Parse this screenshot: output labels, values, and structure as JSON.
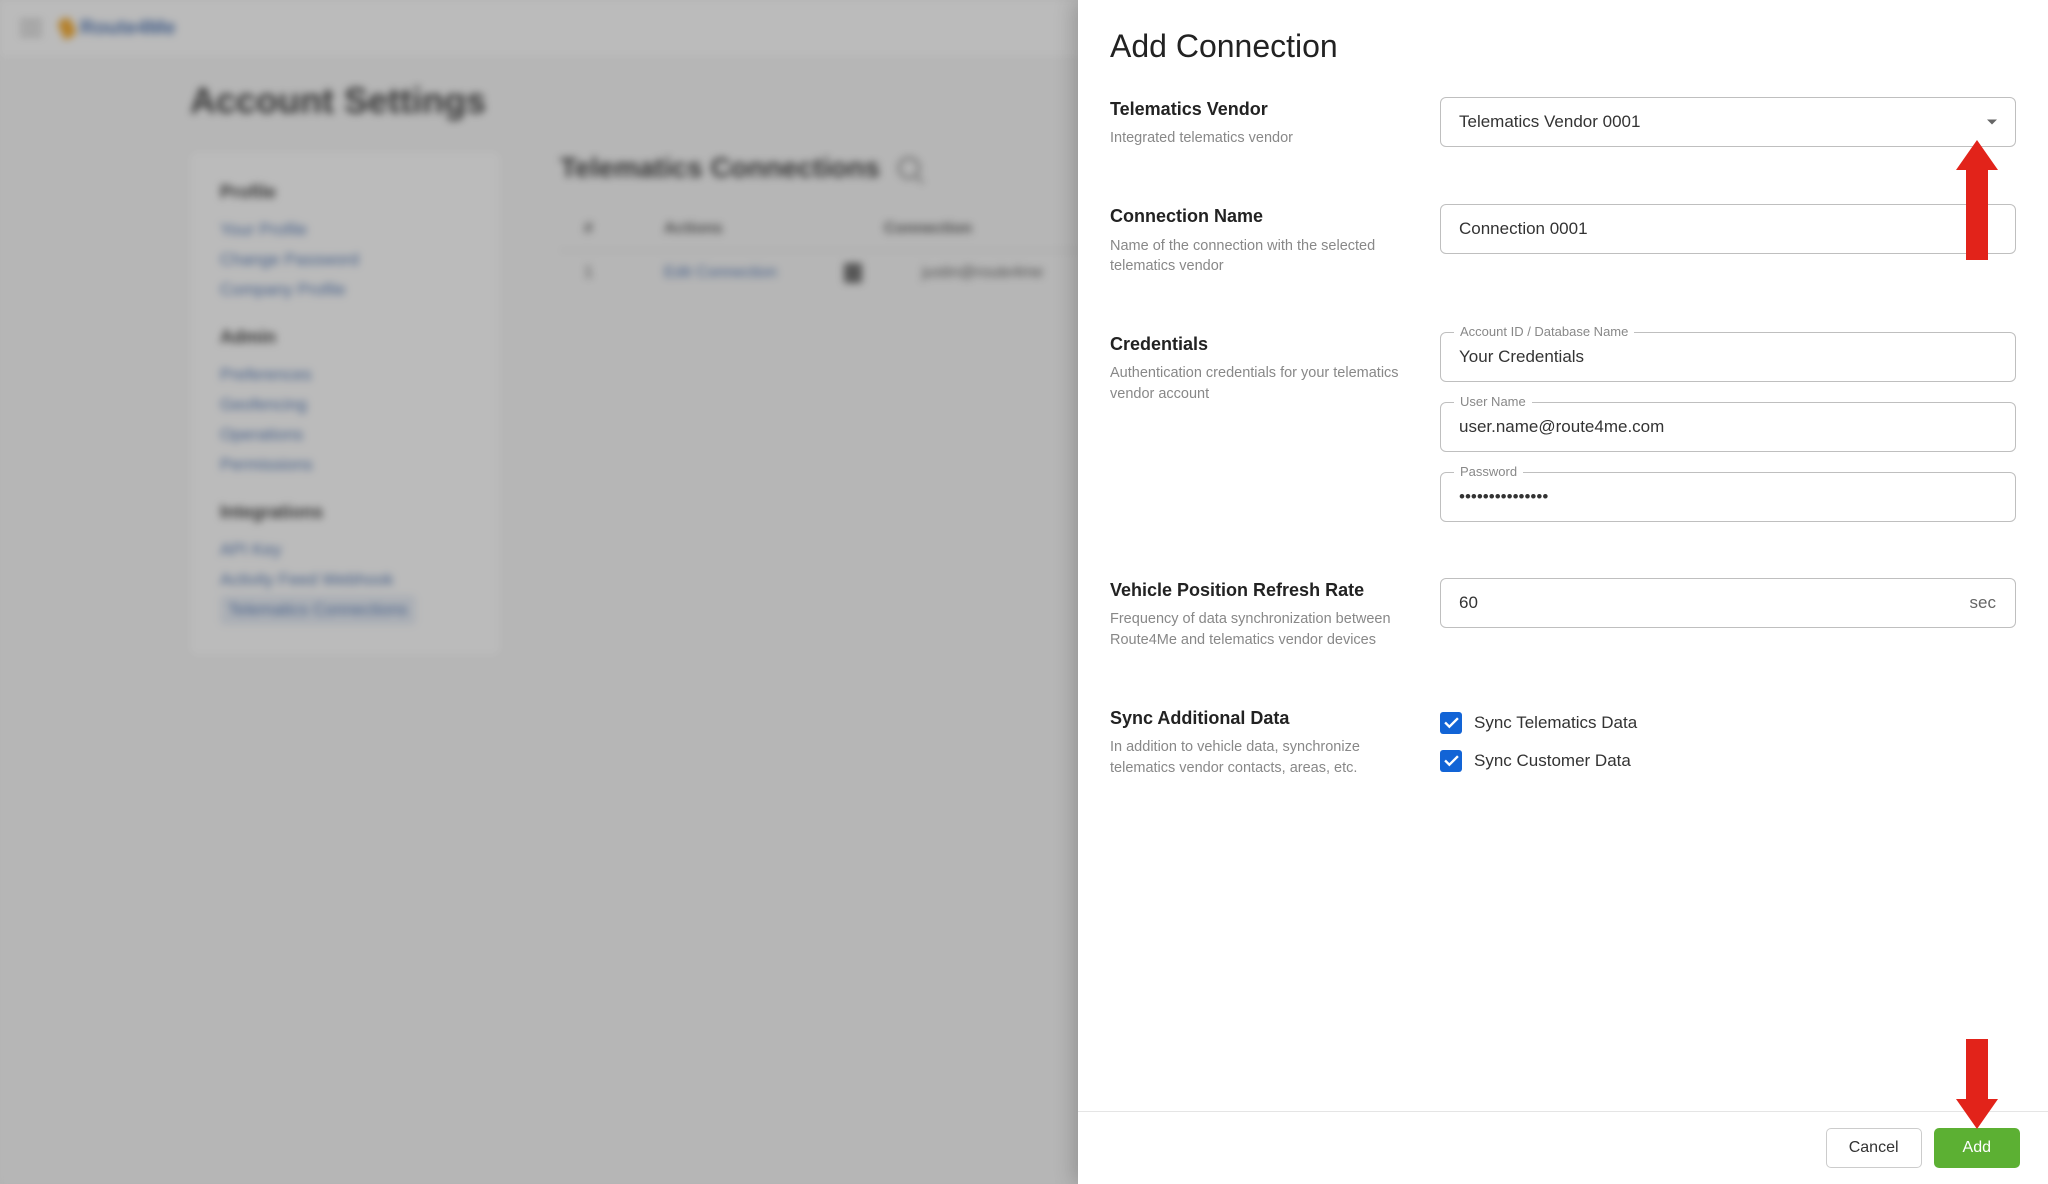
{
  "background": {
    "logo_text": "Route4Me",
    "page_title": "Account Settings",
    "sidebar": {
      "section1_title": "Profile",
      "section1_items": [
        "Your Profile",
        "Change Password",
        "Company Profile"
      ],
      "section2_title": "Admin",
      "section2_items": [
        "Preferences",
        "Geofencing",
        "Operations",
        "Permissions"
      ],
      "section3_title": "Integrations",
      "section3_items": [
        "API Key",
        "Activity Feed Webhook",
        "Telematics Connections"
      ]
    },
    "main": {
      "title": "Telematics Connections",
      "th_num": "#",
      "th_actions": "Actions",
      "th_conn": "Connection",
      "row_num": "1",
      "row_action": "Edit Connection",
      "row_conn": "justin@route4me"
    }
  },
  "modal": {
    "title": "Add Connection",
    "vendor": {
      "label": "Telematics Vendor",
      "help": "Integrated telematics vendor",
      "value": "Telematics Vendor 0001"
    },
    "connection_name": {
      "label": "Connection Name",
      "help": "Name of the connection with the selected telematics vendor",
      "value": "Connection 0001"
    },
    "credentials": {
      "label": "Credentials",
      "help": "Authentication credentials for your telematics vendor account",
      "account_label": "Account ID / Database Name",
      "account_value": "Your Credentials",
      "user_label": "User Name",
      "user_value": "user.name@route4me.com",
      "password_label": "Password",
      "password_value": "•••••••••••••••"
    },
    "refresh": {
      "label": "Vehicle Position Refresh Rate",
      "help": "Frequency of data synchronization between Route4Me and telematics vendor devices",
      "value": "60",
      "unit": "sec"
    },
    "sync": {
      "label": "Sync Additional Data",
      "help": "In addition to vehicle data, synchronize telematics vendor contacts, areas, etc.",
      "opt1": "Sync Telematics Data",
      "opt2": "Sync Customer Data"
    },
    "footer": {
      "cancel": "Cancel",
      "add": "Add"
    }
  }
}
